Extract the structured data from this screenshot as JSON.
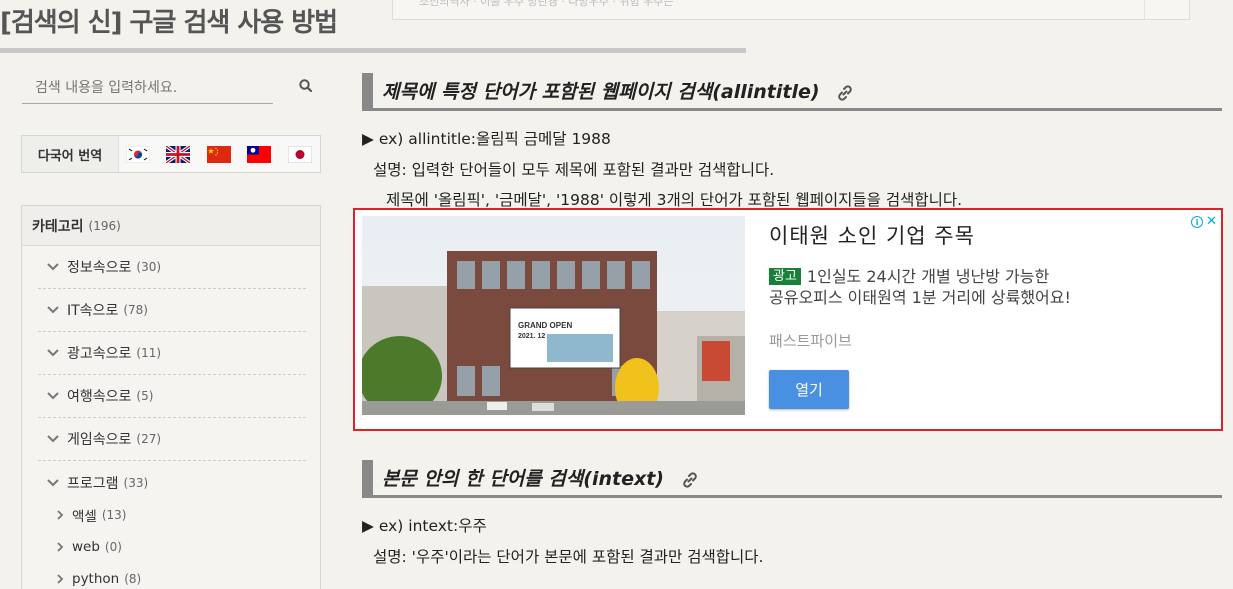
{
  "header": {
    "title": "[검색의 신] 구글 검색 사용 방법",
    "top_tags": "조선의역사 · 이를 우주 방탄경 · 나방우주 · 위험 우주는"
  },
  "sidebar": {
    "search": {
      "placeholder": "검색 내용을 입력하세요."
    },
    "language": {
      "label": "다국어 번역",
      "flags": [
        "korea-flag-icon",
        "uk-flag-icon",
        "china-flag-icon",
        "taiwan-flag-icon",
        "japan-flag-icon"
      ]
    },
    "categories": {
      "title": "카테고리",
      "count": "(196)",
      "items": [
        {
          "label": "정보속으로",
          "count": "(30)"
        },
        {
          "label": "IT속으로",
          "count": "(78)"
        },
        {
          "label": "광고속으로",
          "count": "(11)"
        },
        {
          "label": "여행속으로",
          "count": "(5)"
        },
        {
          "label": "게임속으로",
          "count": "(27)"
        },
        {
          "label": "프로그램",
          "count": "(33)"
        }
      ],
      "sub_items": [
        {
          "label": "액셀",
          "count": "(13)"
        },
        {
          "label": "web",
          "count": "(0)"
        },
        {
          "label": "python",
          "count": "(8)"
        }
      ]
    }
  },
  "content": {
    "section1": {
      "title": "제목에 특정 단어가 포함된 웹페이지 검색(allintitle)",
      "example": "▶ ex) allintitle:올림픽 금메달 1988",
      "desc1": "설명: 입력한 단어들이 모두 제목에 포함된 결과만 검색합니다.",
      "desc2": "제목에 '올림픽', '금메달', '1988' 이렇게 3개의 단어가 포함된 웹페이지들을 검색합니다."
    },
    "ad": {
      "title": "이태원 소인 기업 주목",
      "badge": "광고",
      "desc_line1": "1인실도 24시간 개별 냉난방 가능한",
      "desc_line2": "공유오피스 이태원역 1분 거리에 상륙했어요!",
      "advertiser": "패스트파이브",
      "button": "열기",
      "banner_line1": "GRAND OPEN",
      "banner_line2": "2021. 12"
    },
    "section2": {
      "title": "본문 안의 한 단어를 검색(intext)",
      "example": "▶ ex) intext:우주",
      "desc1": "설명: '우주'이라는 단어가 본문에 포함된 결과만 검색합니다."
    }
  },
  "colors": {
    "ad_border": "#e0202a",
    "ad_button": "#4a90e2",
    "ad_badge": "#188038",
    "section_bar": "#888888"
  }
}
